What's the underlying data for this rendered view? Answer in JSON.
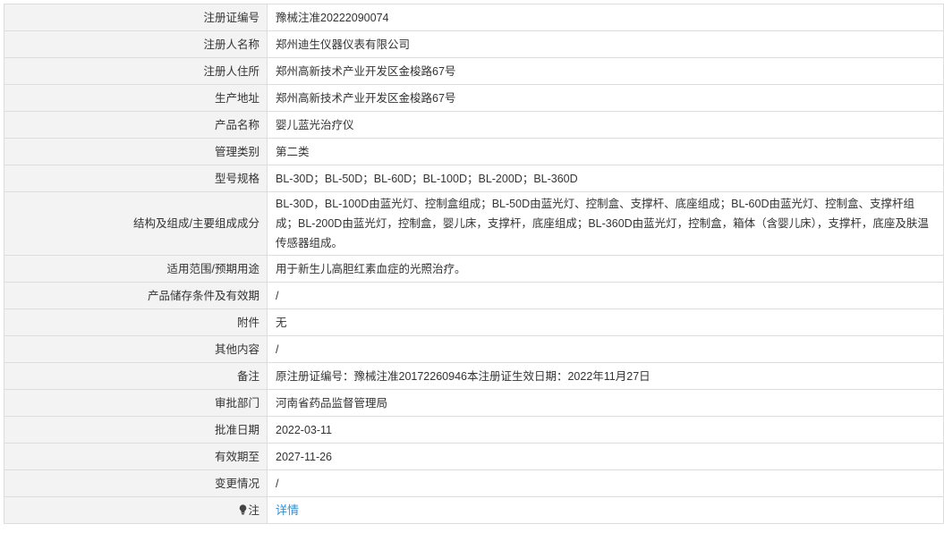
{
  "rows": [
    {
      "label": "注册证编号",
      "value": "豫械注准20222090074"
    },
    {
      "label": "注册人名称",
      "value": "郑州迪生仪器仪表有限公司"
    },
    {
      "label": "注册人住所",
      "value": "郑州高新技术产业开发区金梭路67号"
    },
    {
      "label": "生产地址",
      "value": "郑州高新技术产业开发区金梭路67号"
    },
    {
      "label": "产品名称",
      "value": "婴儿蓝光治疗仪"
    },
    {
      "label": "管理类别",
      "value": "第二类"
    },
    {
      "label": "型号规格",
      "value": "BL-30D；BL-50D；BL-60D；BL-100D；BL-200D；BL-360D"
    },
    {
      "label": "结构及组成/主要组成成分",
      "value": "BL-30D，BL-100D由蓝光灯、控制盒组成；BL-50D由蓝光灯、控制盒、支撑杆、底座组成；BL-60D由蓝光灯、控制盒、支撑杆组成；BL-200D由蓝光灯，控制盒，婴儿床，支撑杆，底座组成；BL-360D由蓝光灯，控制盒，箱体（含婴儿床），支撑杆，底座及肤温传感器组成。"
    },
    {
      "label": "适用范围/预期用途",
      "value": "用于新生儿高胆红素血症的光照治疗。"
    },
    {
      "label": "产品储存条件及有效期",
      "value": "/"
    },
    {
      "label": "附件",
      "value": "无"
    },
    {
      "label": "其他内容",
      "value": "/"
    },
    {
      "label": "备注",
      "value": "原注册证编号：豫械注准20172260946本注册证生效日期：2022年11月27日"
    },
    {
      "label": "审批部门",
      "value": "河南省药品监督管理局"
    },
    {
      "label": "批准日期",
      "value": "2022-03-11"
    },
    {
      "label": "有效期至",
      "value": "2027-11-26"
    },
    {
      "label": "变更情况",
      "value": "/"
    }
  ],
  "note": {
    "icon": "lightbulb-icon",
    "label": "注",
    "link_text": "详情",
    "link_color": "#2f8fd3"
  }
}
